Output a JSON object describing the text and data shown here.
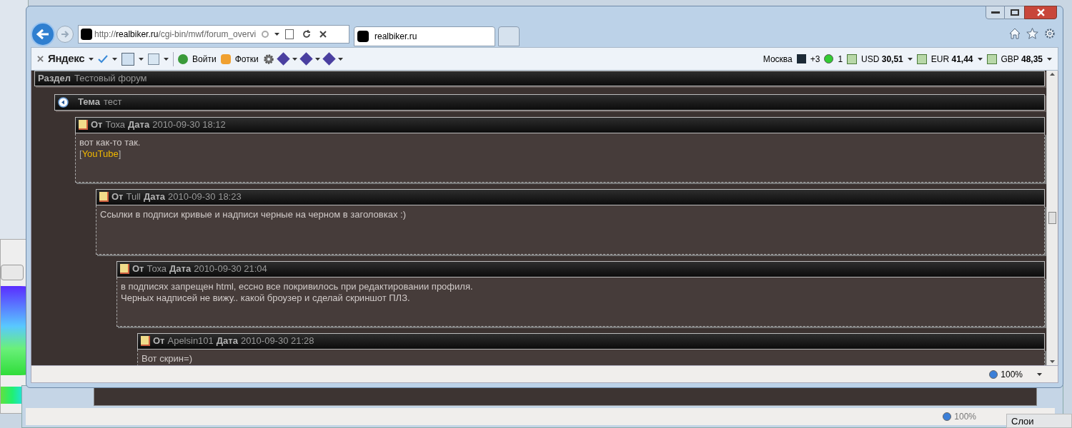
{
  "browser": {
    "address": {
      "scheme": "http://",
      "domain": "realbiker.ru",
      "path": "/cgi-bin/mwf/forum_overvi"
    },
    "tabs": [
      {
        "title": "realbiker.ru",
        "selected": true
      }
    ],
    "toolbar": {
      "yandex": "Яндекс",
      "login": "Войти",
      "photos": "Фотки"
    },
    "informer": {
      "city": "Москва",
      "temperature": "+3",
      "traffic": "1",
      "currencies": [
        {
          "code": "USD",
          "rate": "30,51"
        },
        {
          "code": "EUR",
          "rate": "41,44"
        },
        {
          "code": "GBP",
          "rate": "48,35"
        }
      ]
    },
    "zoom": "100%"
  },
  "forum": {
    "section": {
      "label": "Раздел",
      "value": "Тестовый форум"
    },
    "topic": {
      "label": "Тема",
      "value": "тест"
    },
    "posts": [
      {
        "from_label": "От",
        "author": "Тоха",
        "date_label": "Дата",
        "date": "2010-09-30 18:12",
        "body": [
          {
            "kind": "text",
            "text": "вот как-то так."
          },
          {
            "kind": "link",
            "open": "[",
            "text": "YouTube",
            "close": "]"
          }
        ],
        "children": [
          {
            "from_label": "От",
            "author": "Tull",
            "date_label": "Дата",
            "date": "2010-09-30 18:23",
            "body": [
              {
                "kind": "text",
                "text": "Ссылки в подписи кривые и надписи черные на черном в заголовках :)"
              }
            ],
            "children": [
              {
                "from_label": "От",
                "author": "Тоха",
                "date_label": "Дата",
                "date": "2010-09-30 21:04",
                "body": [
                  {
                    "kind": "text",
                    "text": "в подписях запрещен html, ессно все покривилось при редактировании профиля."
                  },
                  {
                    "kind": "text",
                    "text": "Черных надписей не вижу.. какой броузер и сделай скриншот ПЛЗ."
                  }
                ],
                "children": [
                  {
                    "from_label": "От",
                    "author": "Apelsin101",
                    "date_label": "Дата",
                    "date": "2010-09-30 21:28",
                    "body": [
                      {
                        "kind": "text",
                        "text": "Вот скрин=)"
                      }
                    ]
                  }
                ]
              }
            ]
          }
        ]
      }
    ]
  },
  "background_window": {
    "zoom": "100%",
    "panel_title": "Слои"
  }
}
